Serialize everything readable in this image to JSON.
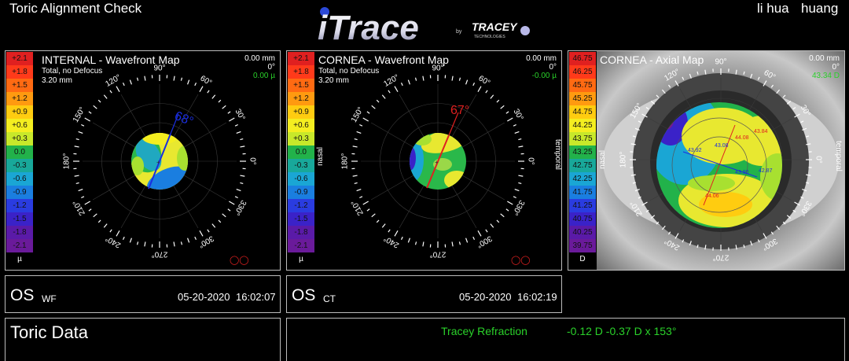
{
  "header": {
    "title": "Toric Alignment Check",
    "logo_main": "iTrace",
    "logo_by": "by",
    "logo_brand": "TRACEY",
    "logo_brand_sub": "TECHNOLOGIES",
    "patient_first": "li hua",
    "patient_last": "huang"
  },
  "colors": {
    "scale": [
      "#e02020",
      "#ff3a1a",
      "#ff6a12",
      "#ff9a10",
      "#ffcc10",
      "#f4ee20",
      "#c8e82a",
      "#22b24a",
      "#18a89a",
      "#1aa6d4",
      "#1a7ee0",
      "#2a3ce0",
      "#3a22c8",
      "#5a1aa8",
      "#6a1a9a",
      "#7a1a8a"
    ],
    "green_text": "#2ad12a",
    "axis_red": "#e02020",
    "axis_blue": "#1a2ee0"
  },
  "panels": [
    {
      "title": "INTERNAL - Wavefront Map",
      "sub1": "Total, no Defocus",
      "sub2": "3.20 mm",
      "r1": "0.00 mm",
      "r2": "0°",
      "r3": "0.00 µ",
      "scale": [
        "+2.1",
        "+1.8",
        "+1.5",
        "+1.2",
        "+0.9",
        "+0.6",
        "+0.3",
        "0.0",
        "-0.3",
        "-0.6",
        "-0.9",
        "-1.2",
        "-1.5",
        "-1.8",
        "-2.1"
      ],
      "unit": "µ",
      "axis_label": "68°",
      "axis_deg": 68,
      "nasal": "",
      "temporal": ""
    },
    {
      "title": "CORNEA - Wavefront Map",
      "sub1": "Total, no Defocus",
      "sub2": "3.20 mm",
      "r1": "0.00 mm",
      "r2": "0°",
      "r3": "-0.00 µ",
      "scale": [
        "+2.1",
        "+1.8",
        "+1.5",
        "+1.2",
        "+0.9",
        "+0.6",
        "+0.3",
        "0.0",
        "-0.3",
        "-0.6",
        "-0.9",
        "-1.2",
        "-1.5",
        "-1.8",
        "-2.1"
      ],
      "unit": "µ",
      "axis_label": "67°",
      "axis_deg": 67,
      "nasal": "nasal",
      "temporal": "temporal"
    },
    {
      "title": "CORNEA - Axial Map",
      "sub1": "",
      "sub2": "",
      "r1": "0.00 mm",
      "r2": "0°",
      "r3": "43.34 D",
      "scale": [
        "46.75",
        "46.25",
        "45.75",
        "45.25",
        "44.75",
        "44.25",
        "43.75",
        "43.25",
        "42.75",
        "42.25",
        "41.75",
        "41.25",
        "40.75",
        "40.25",
        "39.75"
      ],
      "unit": "D",
      "nasal": "nasal",
      "temporal": "temporal"
    }
  ],
  "degree_labels": [
    "0°",
    "30°",
    "60°",
    "90°",
    "120°",
    "150°",
    "180°",
    "210°",
    "240°",
    "270°",
    "300°",
    "330°"
  ],
  "axial_values": [
    "43.92",
    "43.08",
    "44.08",
    "43.84",
    "43.90",
    "42.87",
    "44.06"
  ],
  "info": [
    {
      "eye": "OS",
      "mode": "WF",
      "date": "05-20-2020",
      "time": "16:02:07"
    },
    {
      "eye": "OS",
      "mode": "CT",
      "date": "05-20-2020",
      "time": "16:02:19"
    }
  ],
  "toric": {
    "title": "Toric Data",
    "refraction_label": "Tracey Refraction",
    "refraction_value": "-0.12 D -0.37 D x 153°"
  }
}
